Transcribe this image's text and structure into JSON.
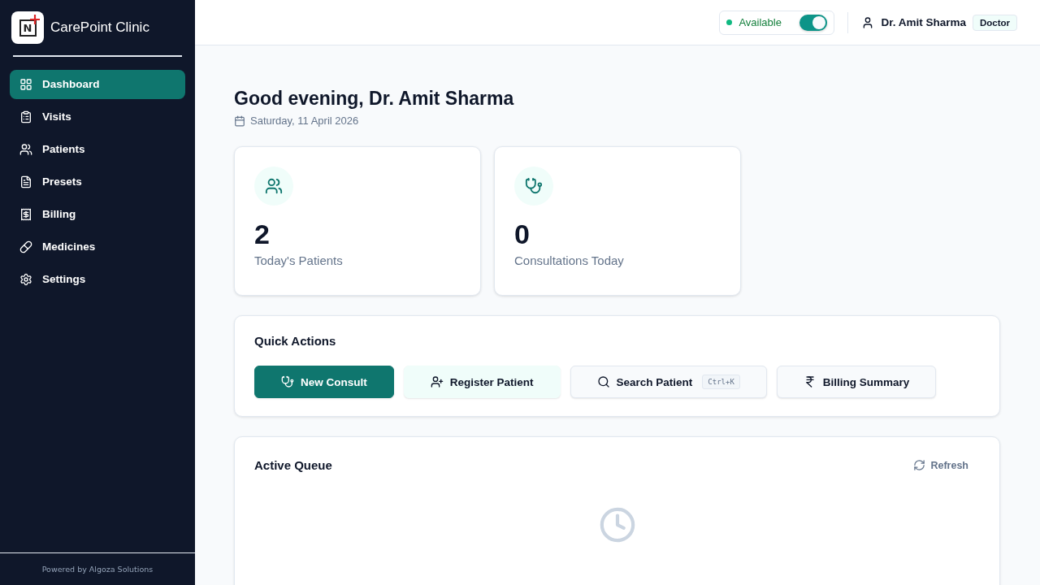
{
  "brand": {
    "logo_letter": "N",
    "name": "CarePoint Clinic"
  },
  "sidebar": {
    "items": [
      {
        "label": "Dashboard",
        "selected": true
      },
      {
        "label": "Visits",
        "selected": false
      },
      {
        "label": "Patients",
        "selected": false
      },
      {
        "label": "Presets",
        "selected": false
      },
      {
        "label": "Billing",
        "selected": false
      },
      {
        "label": "Medicines",
        "selected": false
      },
      {
        "label": "Settings",
        "selected": false
      }
    ],
    "footer": "Powered by Algoza Solutions"
  },
  "header": {
    "availability": {
      "label": "Available",
      "on": true
    },
    "user": {
      "name": "Dr. Amit Sharma",
      "role": "Doctor"
    }
  },
  "greeting": {
    "title": "Good evening, Dr. Amit Sharma",
    "date": "Saturday, 11 April 2026"
  },
  "stats": [
    {
      "value": "2",
      "label": "Today's Patients"
    },
    {
      "value": "0",
      "label": "Consultations Today"
    }
  ],
  "quick_actions": {
    "title": "Quick Actions",
    "buttons": [
      {
        "kind": "primary",
        "label": "New Consult"
      },
      {
        "kind": "soft",
        "label": "Register Patient"
      },
      {
        "kind": "outline",
        "label": "Search Patient",
        "shortcut": "Ctrl+K"
      },
      {
        "kind": "outline",
        "label": "Billing Summary"
      }
    ]
  },
  "queue": {
    "title": "Active Queue",
    "refresh": "Refresh"
  }
}
